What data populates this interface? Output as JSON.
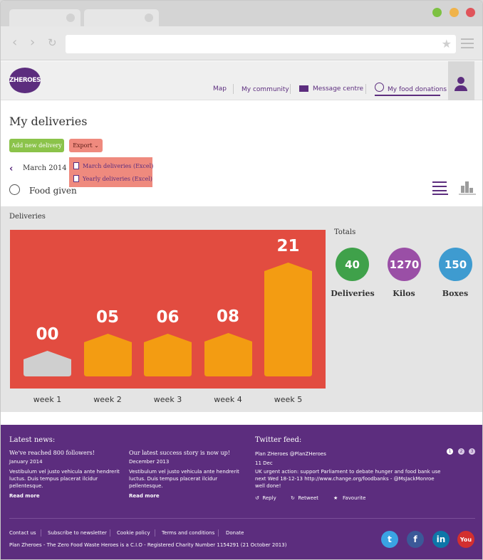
{
  "site": {
    "logo_text": "ZHEROES",
    "nav": [
      {
        "label": "Map"
      },
      {
        "label": "My community"
      },
      {
        "label": "Message centre"
      },
      {
        "label": "My food donations"
      }
    ]
  },
  "page": {
    "title": "My deliveries",
    "add_button": "Add new delivery",
    "export_button": "Export",
    "export_menu": [
      {
        "label": "March deliveries (Excel)"
      },
      {
        "label": "Yearly deliveries (Excel)"
      }
    ],
    "month": "March 2014",
    "filter": "Food given"
  },
  "deliveries": {
    "title": "Deliveries",
    "totals_title": "Totals",
    "totals": [
      {
        "value": "40",
        "label": "Deliveries",
        "color": "#3fa14a"
      },
      {
        "value": "1270",
        "label": "Kilos",
        "color": "#9a4fa6"
      },
      {
        "value": "150",
        "label": "Boxes",
        "color": "#3e9bd0"
      }
    ]
  },
  "chart_data": {
    "type": "bar",
    "categories": [
      "week 1",
      "week 2",
      "week 3",
      "week 4",
      "week 5"
    ],
    "values": [
      0,
      5,
      6,
      8,
      21
    ],
    "value_labels": [
      "00",
      "05",
      "06",
      "08",
      "21"
    ],
    "colors": {
      "background": "#e24c40",
      "bar": "#f39c12",
      "zero_bar": "#cfcfcf"
    }
  },
  "footer": {
    "news_title": "Latest news:",
    "news": [
      {
        "headline": "We've reached 800 followers!",
        "date": "January 2014",
        "body": "Vestibulum vel justo vehicula ante hendrerit luctus. Duis tempus placerat ilcidur pellentesque.",
        "more": "Read more"
      },
      {
        "headline": "Our latest success story is now up!",
        "date": "December 2013",
        "body": "Vestibulum vel justo vehicula ante hendrerit luctus. Duis tempus placerat ilcidur pellentesque.",
        "more": "Read more"
      }
    ],
    "twitter_title": "Twitter feed:",
    "tweet": {
      "author": "Plan ZHeroes @PlanZHeroes",
      "date": "11 Dec",
      "text": "UK urgent action: support Parliament to debate hunger and food bank use next Wed 18-12-13 http://www.change.org/foodbanks - @MsJackMonroe well done!",
      "actions": [
        {
          "label": "Reply"
        },
        {
          "label": "Retweet"
        },
        {
          "label": "Favourite"
        }
      ]
    },
    "pager": [
      "1",
      "2",
      "3"
    ],
    "links": [
      {
        "label": "Contact us"
      },
      {
        "label": "Subscribe to newsletter"
      },
      {
        "label": "Cookie policy"
      },
      {
        "label": "Terms and conditions"
      },
      {
        "label": "Donate"
      }
    ],
    "legal": "Plan Zheroes - The Zero Food Waste Heroes is a C.I.O - Registered Charity Number 1154291 (21 October 2013)",
    "social": [
      {
        "icon": "twitter-icon",
        "glyph": "t",
        "color": "#3aa3e3"
      },
      {
        "icon": "facebook-icon",
        "glyph": "f",
        "color": "#3b5998"
      },
      {
        "icon": "linkedin-icon",
        "glyph": "in",
        "color": "#0e76a8"
      },
      {
        "icon": "youtube-icon",
        "glyph": "You",
        "color": "#d32f2f"
      }
    ]
  }
}
